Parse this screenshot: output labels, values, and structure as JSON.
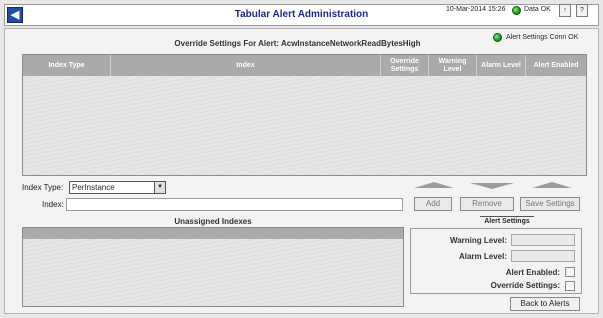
{
  "header": {
    "back_icon": "◀",
    "title": "Tabular Alert Administration",
    "date": "10-Mar-2014 15:26",
    "data_status": "Data OK",
    "btn1": "↑",
    "btn2": "?"
  },
  "main": {
    "conn_status": "Alert Settings Conn OK",
    "override_title": "Override Settings For Alert: AcwInstanceNetworkReadBytesHigh",
    "columns": [
      "Index Type",
      "Index",
      "Override Settings",
      "Warning Level",
      "Alarm Level",
      "Alert Enabled"
    ]
  },
  "index_type": {
    "label": "Index Type:",
    "value": "PerInstance"
  },
  "index": {
    "label": "Index:",
    "value": ""
  },
  "buttons": {
    "add": "Add",
    "remove": "Remove",
    "save": "Save Settings",
    "back_to_alerts": "Back to Alerts"
  },
  "unassigned": {
    "title": "Unassigned Indexes"
  },
  "alert_settings": {
    "title": "Alert Settings",
    "warning_label": "Warning Level:",
    "alarm_label": "Alarm Level:",
    "enabled_label": "Alert Enabled:",
    "override_label": "Override Settings:",
    "warning_value": "",
    "alarm_value": ""
  },
  "colors": {
    "title": "#1a2a8a",
    "status_ok": "#1d9a1d",
    "table_header": "#aaaaaa"
  }
}
